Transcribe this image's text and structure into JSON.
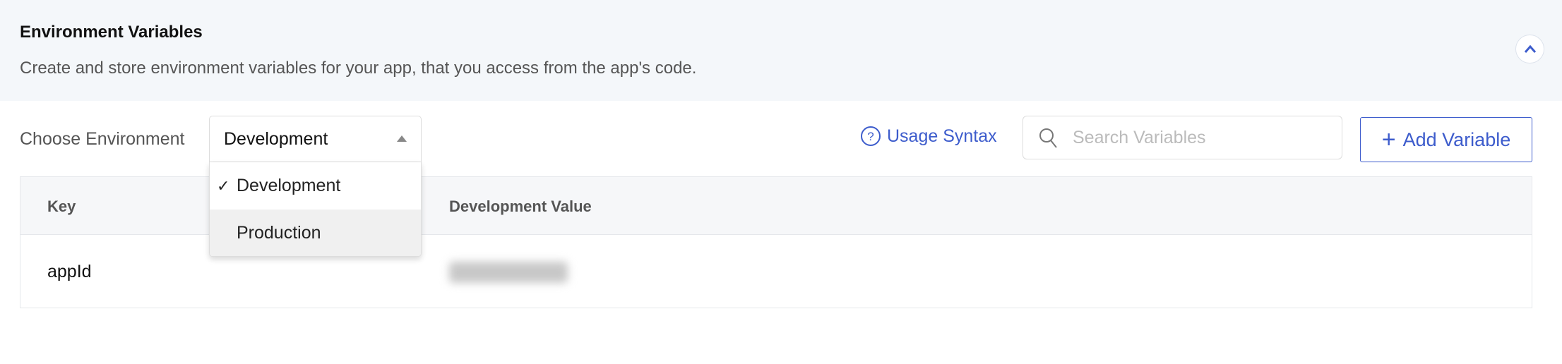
{
  "header": {
    "title": "Environment Variables",
    "subtitle": "Create and store environment variables for your app, that you access from the app's code.",
    "collapse_icon": "chevron-up-icon"
  },
  "toolbar": {
    "env_label": "Choose Environment",
    "env_selected": "Development",
    "env_options": [
      {
        "label": "Development",
        "selected": true
      },
      {
        "label": "Production",
        "selected": false,
        "hovered": true
      }
    ],
    "usage_syntax": "Usage Syntax",
    "search_placeholder": "Search Variables",
    "search_value": "",
    "add_variable": "Add Variable"
  },
  "table": {
    "columns": [
      "Key",
      "Development Value"
    ],
    "rows": [
      {
        "key": "appId",
        "value_blurred": true
      }
    ]
  },
  "colors": {
    "accent": "#3d5ccc",
    "header_bg": "#f4f7fa"
  }
}
